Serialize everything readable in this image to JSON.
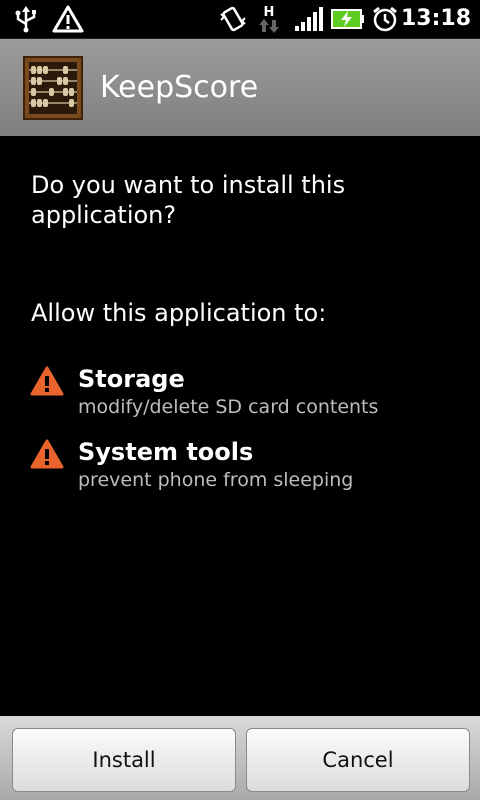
{
  "status_bar": {
    "time": "13:18",
    "icons": [
      "usb-icon",
      "warning-icon",
      "vibrate-icon",
      "hspa-data-icon",
      "signal-icon",
      "battery-charging-icon",
      "alarm-icon"
    ]
  },
  "title_bar": {
    "app_name": "KeepScore",
    "icon": "abacus-icon"
  },
  "main": {
    "question": "Do you want to install this application?",
    "allow_heading": "Allow this application to:",
    "permissions": [
      {
        "title": "Storage",
        "description": "modify/delete SD card contents",
        "icon": "warning-triangle-icon"
      },
      {
        "title": "System tools",
        "description": "prevent phone from sleeping",
        "icon": "warning-triangle-icon"
      }
    ]
  },
  "buttons": {
    "install_label": "Install",
    "cancel_label": "Cancel"
  },
  "colors": {
    "warning": "#e8642c",
    "battery": "#5ecb21"
  }
}
